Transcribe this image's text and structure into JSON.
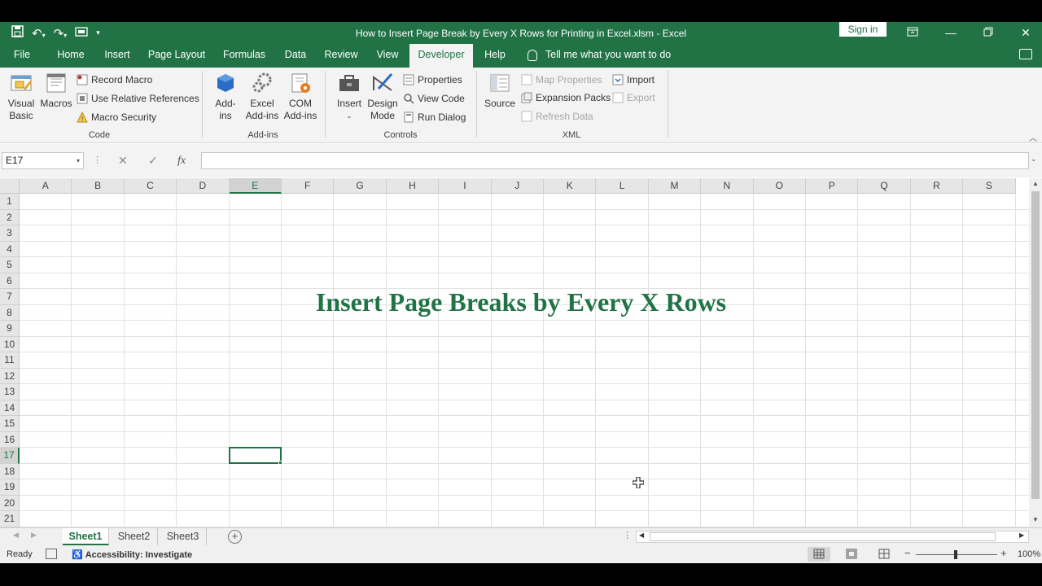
{
  "window": {
    "title": "How to Insert Page Break by Every X Rows for Printing in Excel.xlsm  -  Excel",
    "sign_in": "Sign in"
  },
  "menu_tabs": [
    "File",
    "Home",
    "Insert",
    "Page Layout",
    "Formulas",
    "Data",
    "Review",
    "View",
    "Developer",
    "Help"
  ],
  "active_tab": "Developer",
  "tell_me": "Tell me what you want to do",
  "ribbon": {
    "code": {
      "visual_basic": [
        "Visual",
        "Basic"
      ],
      "macros": "Macros",
      "record_macro": "Record Macro",
      "use_relative": "Use Relative References",
      "macro_security": "Macro Security",
      "label": "Code"
    },
    "addins": {
      "addins": [
        "Add-",
        "ins"
      ],
      "excel_addins": [
        "Excel",
        "Add-ins"
      ],
      "com_addins": [
        "COM",
        "Add-ins"
      ],
      "label": "Add-ins"
    },
    "controls": {
      "insert": "Insert",
      "design_mode": [
        "Design",
        "Mode"
      ],
      "properties": "Properties",
      "view_code": "View Code",
      "run_dialog": "Run Dialog",
      "label": "Controls"
    },
    "xml": {
      "source": "Source",
      "map_properties": "Map Properties",
      "expansion_packs": "Expansion Packs",
      "refresh_data": "Refresh Data",
      "import": "Import",
      "export": "Export",
      "label": "XML"
    }
  },
  "formula_bar": {
    "name_box": "E17",
    "fx": "fx",
    "formula": ""
  },
  "sheet": {
    "columns": [
      "A",
      "B",
      "C",
      "D",
      "E",
      "F",
      "G",
      "H",
      "I",
      "J",
      "K",
      "L",
      "M",
      "N",
      "O",
      "P",
      "Q",
      "R",
      "S"
    ],
    "rows": [
      "1",
      "2",
      "3",
      "4",
      "5",
      "6",
      "7",
      "8",
      "9",
      "10",
      "11",
      "12",
      "13",
      "14",
      "15",
      "16",
      "17",
      "18",
      "19",
      "20",
      "21"
    ],
    "selected_column": "E",
    "selected_row": "17",
    "title_text": "Insert Page Breaks by Every X Rows"
  },
  "sheet_tabs": [
    "Sheet1",
    "Sheet2",
    "Sheet3"
  ],
  "active_sheet": "Sheet1",
  "status": {
    "ready": "Ready",
    "accessibility": "Accessibility: Investigate",
    "zoom": "100%"
  },
  "colors": {
    "excel_green": "#217346"
  }
}
